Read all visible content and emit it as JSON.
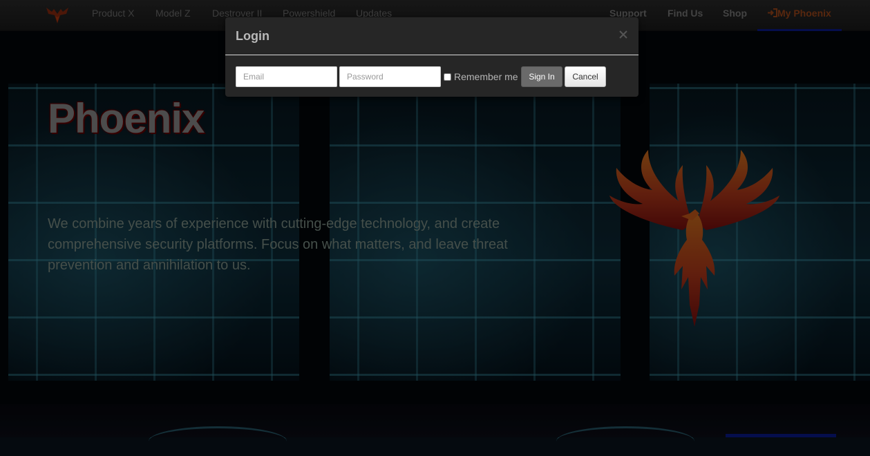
{
  "nav": {
    "left_links": [
      "Product X",
      "Model Z",
      "Destrover II",
      "Powershield",
      "Updates"
    ],
    "right_links": [
      "Support",
      "Find Us",
      "Shop"
    ],
    "account_link": "My Phoenix",
    "account_icon": "sign-in-icon",
    "brand_icon": "phoenix-logo-icon"
  },
  "hero": {
    "title": "Phoenix",
    "text": "We combine years of experience with cutting-edge technology, and create comprehensive security platforms. Focus on what matters, and leave threat prevention and annihilation to us.",
    "logo_icon": "phoenix-emblem"
  },
  "login_modal": {
    "title": "Login",
    "close_icon": "close-icon",
    "email_placeholder": "Email",
    "email_value": "",
    "password_placeholder": "Password",
    "password_value": "",
    "remember_label": "Remember me",
    "remember_checked": false,
    "signin_label": "Sign In",
    "cancel_label": "Cancel"
  },
  "colors": {
    "navbar_bg": "#1f1f1f",
    "accent": "#a0481a",
    "modal_bg": "#262626",
    "signin_bg": "#6a6a6a"
  }
}
